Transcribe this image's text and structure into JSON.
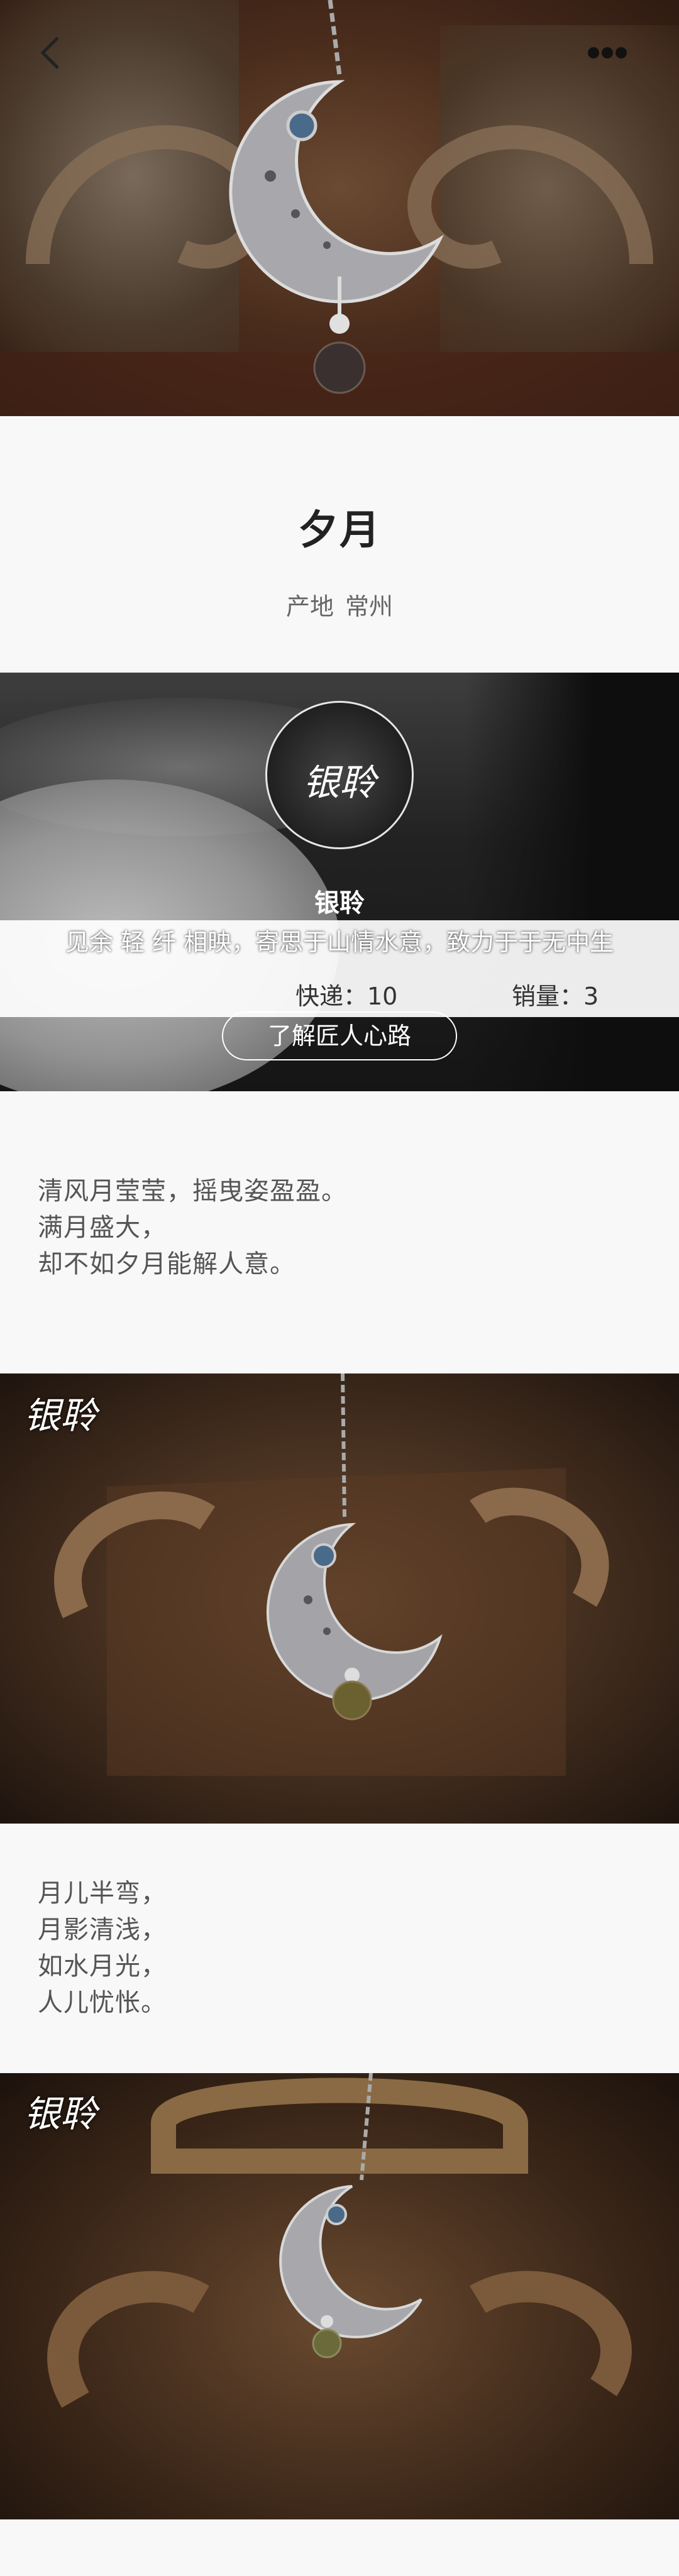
{
  "product": {
    "name": "夕月",
    "origin_label": "产地",
    "origin_value": "常州"
  },
  "artisan": {
    "logo_text": "银聆",
    "name": "银聆",
    "description": "见余 轻 纤 相映，寄思于山情水意，致力于于无中生",
    "delivery": "快递：10",
    "sales": "销量：3",
    "learn_more": "了解匠人心路"
  },
  "poem1": [
    "清风月莹莹，摇曳姿盈盈。",
    "满月盛大，",
    "却不如夕月能解人意。"
  ],
  "poem2": [
    "月儿半弯，",
    "月影清浅，",
    "如水月光，",
    "人儿忧怅。"
  ],
  "watermark": "银聆",
  "icons": {
    "back": "back-arrow-icon",
    "more": "more-dots-icon"
  },
  "colors": {
    "silver": "#c9c9c9",
    "bronze": "#6a4a30",
    "background": "#f8f8f8"
  }
}
